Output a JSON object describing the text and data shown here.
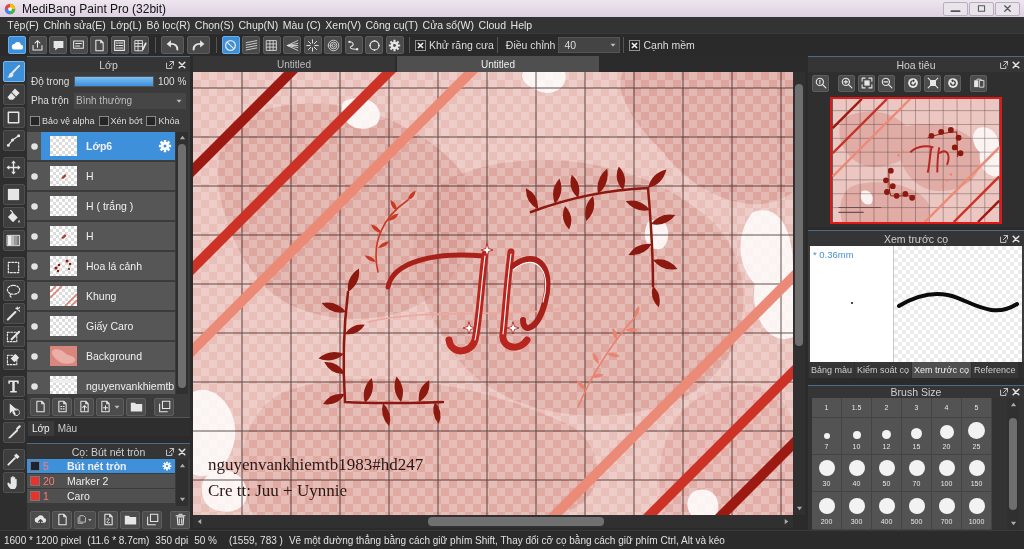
{
  "window": {
    "title": "MediBang Paint Pro (32bit)"
  },
  "menu": [
    "Tệp(F)",
    "Chỉnh sửa(E)",
    "Lớp(L)",
    "Bộ lọc(R)",
    "Chọn(S)",
    "Chụp(N)",
    "Màu (C)",
    "Xem(V)",
    "Công cụ(T)",
    "Cửa sổ(W)",
    "Cloud",
    "Help"
  ],
  "toolbar": {
    "file_buttons": [
      {
        "selected": true
      },
      {
        "selected": false
      },
      {
        "selected": false
      },
      {
        "selected": false
      },
      {
        "selected": false
      },
      {
        "selected": false
      },
      {
        "selected": false
      }
    ],
    "snap_buttons": [
      {
        "selected": true
      },
      {
        "selected": false
      },
      {
        "selected": false
      },
      {
        "selected": false
      },
      {
        "selected": false
      },
      {
        "selected": false
      },
      {
        "selected": false
      },
      {
        "selected": false
      },
      {
        "selected": false
      }
    ],
    "antialias": {
      "label": "Khử răng cưa",
      "checked": true
    },
    "correction": {
      "label": "Điều chỉnh",
      "value": "40"
    },
    "soft_edge": {
      "label": "Cạnh mềm",
      "checked": true
    }
  },
  "tools": [
    {
      "selected": true
    },
    {
      "selected": false
    },
    {
      "selected": false
    },
    {
      "selected": false
    },
    {
      "selected": false
    },
    {
      "selected": false
    },
    {
      "selected": false
    },
    {
      "selected": false
    },
    {
      "selected": false
    },
    {
      "selected": false
    },
    {
      "selected": false
    },
    {
      "selected": false
    },
    {
      "selected": false
    },
    {
      "selected": false
    },
    {
      "selected": false
    },
    {
      "selected": false
    },
    {
      "selected": false
    },
    {
      "selected": false
    }
  ],
  "layer_panel": {
    "title": "Lớp",
    "opacity": {
      "label": "Độ trong",
      "level": 1,
      "reading": "100 %"
    },
    "blend": {
      "label": "Pha trộn",
      "value": "Bình thường"
    },
    "options": [
      {
        "label": "Bảo vệ alpha",
        "checked": false
      },
      {
        "label": "Xén bớt",
        "checked": false
      },
      {
        "label": "Khóa",
        "checked": false
      }
    ],
    "layers": [
      {
        "name": "Lớp6",
        "visible": true,
        "selected": true
      },
      {
        "name": "H",
        "visible": true,
        "selected": false
      },
      {
        "name": "H ( trắng )",
        "visible": true,
        "selected": false
      },
      {
        "name": "H",
        "visible": true,
        "selected": false
      },
      {
        "name": "Hoa lá cảnh",
        "visible": true,
        "selected": false
      },
      {
        "name": "Khung",
        "visible": true,
        "selected": false
      },
      {
        "name": "Giấy Caro",
        "visible": true,
        "selected": false
      },
      {
        "name": "Background",
        "visible": true,
        "selected": false
      },
      {
        "name": "nguyenvankhiemtb",
        "visible": true,
        "selected": false
      }
    ]
  },
  "panel_tabs": [
    {
      "label": "Lớp",
      "selected": true
    },
    {
      "label": "Màu",
      "selected": false
    }
  ],
  "brush_panel": {
    "title": "Cọ: Bút nét tròn",
    "brushes": [
      {
        "name": "Bút nét tròn",
        "size": "5",
        "color": "#1c2230",
        "selected": true
      },
      {
        "name": "Marker 2",
        "size": "20",
        "color": "#e8322c",
        "selected": false
      },
      {
        "name": "Caro",
        "size": "1",
        "color": "#e8322c",
        "selected": false
      }
    ]
  },
  "canvas": {
    "tabs": [
      {
        "label": "Untitled",
        "selected": false
      },
      {
        "label": "Untitled",
        "selected": true
      }
    ],
    "texts": [
      "nguyenvankhiemtb1983#hd247",
      "Cre tt: Juu + Uynnie"
    ]
  },
  "navigator": {
    "title": "Hoa tiêu"
  },
  "brush_preview": {
    "title": "Xem trước cọ",
    "size_label": "* 0.36mm"
  },
  "right_tabs": [
    {
      "label": "Bảng màu",
      "selected": false
    },
    {
      "label": "Kiểm soát cọ",
      "selected": false
    },
    {
      "label": "Xem trước cọ",
      "selected": true
    },
    {
      "label": "Reference",
      "selected": false
    }
  ],
  "brush_size": {
    "title": "Brush Size",
    "sizes": [
      "1",
      "1.5",
      "2",
      "3",
      "4",
      "5",
      "7",
      "10",
      "12",
      "15",
      "20",
      "25",
      "30",
      "40",
      "50",
      "70",
      "100",
      "150",
      "200",
      "300",
      "400",
      "500",
      "700",
      "1000"
    ]
  },
  "status_bar": {
    "dimensions": "1600 * 1200 pixel",
    "physical_size": "(11.6 * 8.7cm)",
    "resolution": "350 dpi",
    "zoom": "50 %",
    "cursor": "(1559, 783 )",
    "hint": "Vẽ một đường thẳng bằng cách giữ phím Shift, Thay đổi cỡ cọ bằng cách giữ phím Ctrl, Alt và kéo"
  }
}
